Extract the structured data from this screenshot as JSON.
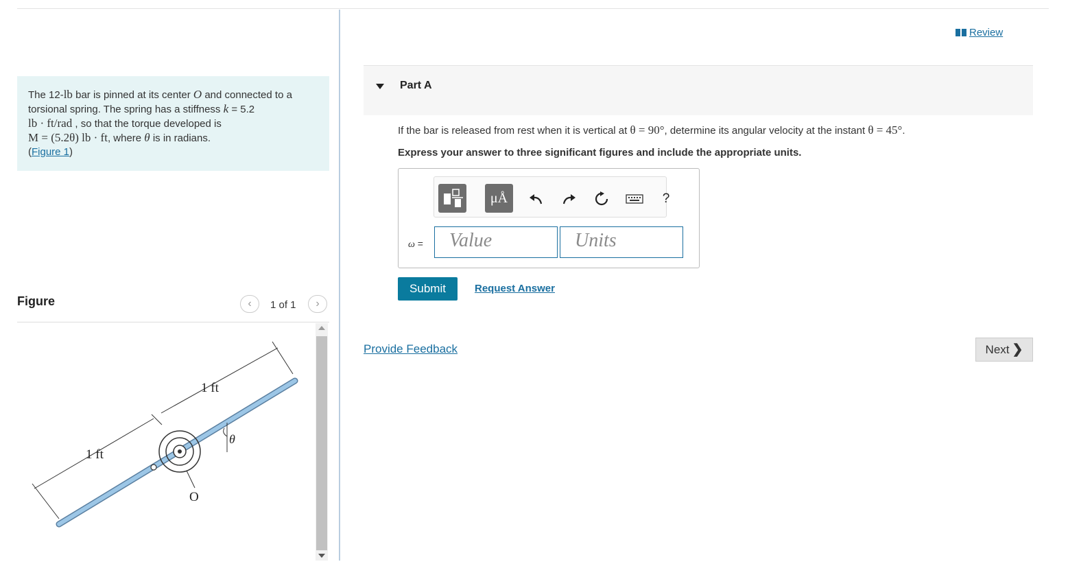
{
  "problem": {
    "line1_a": "The 12-",
    "line1_m": "lb",
    "line1_b": " bar is pinned at its center ",
    "line1_m2": "O",
    "line1_c": " and connected to a",
    "line2_a": "torsional spring. The spring has a stiffness ",
    "line2_m": "k",
    "line2_b": " = 5.2",
    "line3_m": "lb · ft/rad",
    "line3_b": " , so that the torque developed is",
    "line4_m": "M = (5.2θ) lb · ft",
    "line4_b": ", where ",
    "line4_m2": "θ",
    "line4_c": " is in radians.",
    "figure_link_pre": "(",
    "figure_link": "Figure 1",
    "figure_link_post": ")"
  },
  "figure": {
    "title": "Figure",
    "pager_count": "1 of 1",
    "prev_icon": "chevron-left-icon",
    "next_icon": "chevron-right-icon",
    "dim_upper": "1 ft",
    "dim_lower": "1 ft",
    "center_label": "O",
    "angle_label": "θ"
  },
  "review": {
    "label": " Review",
    "icon": "book-icon"
  },
  "part": {
    "title": "Part A"
  },
  "question": {
    "text_a": "If the bar is released from rest when it is vertical at ",
    "m1": "θ = 90°",
    "text_b": ", determine its angular velocity at the instant ",
    "m2": "θ = 45°",
    "text_c": "."
  },
  "instruction": "Express your answer to three significant figures and include the appropriate units.",
  "toolbar": {
    "units_glyph": "μÅ",
    "help_glyph": "?",
    "icons": [
      "templates-icon",
      "units-icon",
      "undo-icon",
      "redo-icon",
      "reset-icon",
      "keyboard-icon",
      "help-icon"
    ]
  },
  "answer": {
    "label_var": "ω",
    "label_eq": " =",
    "value_placeholder": "Value",
    "units_placeholder": "Units"
  },
  "buttons": {
    "submit": "Submit",
    "request": "Request Answer",
    "feedback": "Provide Feedback",
    "next": "Next"
  },
  "colors": {
    "accent": "#0a7b9e",
    "link": "#1a6fa0",
    "problem_bg": "#e6f4f5",
    "bar": "#8fb8d8"
  }
}
